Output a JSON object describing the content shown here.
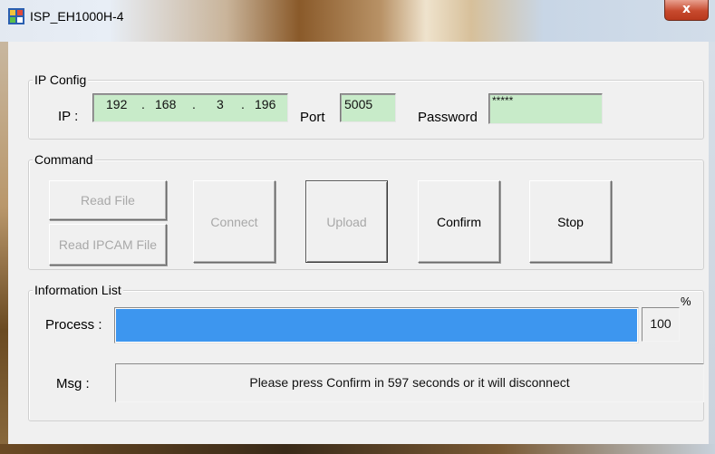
{
  "window": {
    "title": "ISP_EH1000H-4",
    "close_glyph": "x"
  },
  "ip_config": {
    "group_label": "IP Config",
    "ip_label": "IP :",
    "ip": [
      "192",
      "168",
      "3",
      "196"
    ],
    "port_label": "Port",
    "port": "5005",
    "password_label": "Password",
    "password": "*****"
  },
  "command": {
    "group_label": "Command",
    "buttons": {
      "read_file": "Read File",
      "read_ipcam_file": "Read IPCAM File",
      "connect": "Connect",
      "upload": "Upload",
      "confirm": "Confirm",
      "stop": "Stop"
    }
  },
  "info": {
    "group_label": "Information List",
    "process_label": "Process :",
    "percent_symbol": "%",
    "progress_value": "100",
    "progress_fraction": 1.0,
    "msg_label": "Msg :",
    "msg": "Please press Confirm in 597 seconds or it will disconnect"
  },
  "colors": {
    "field_bg": "#c8ebc9",
    "progress": "#3d96ef",
    "close": "#c74a2e"
  }
}
